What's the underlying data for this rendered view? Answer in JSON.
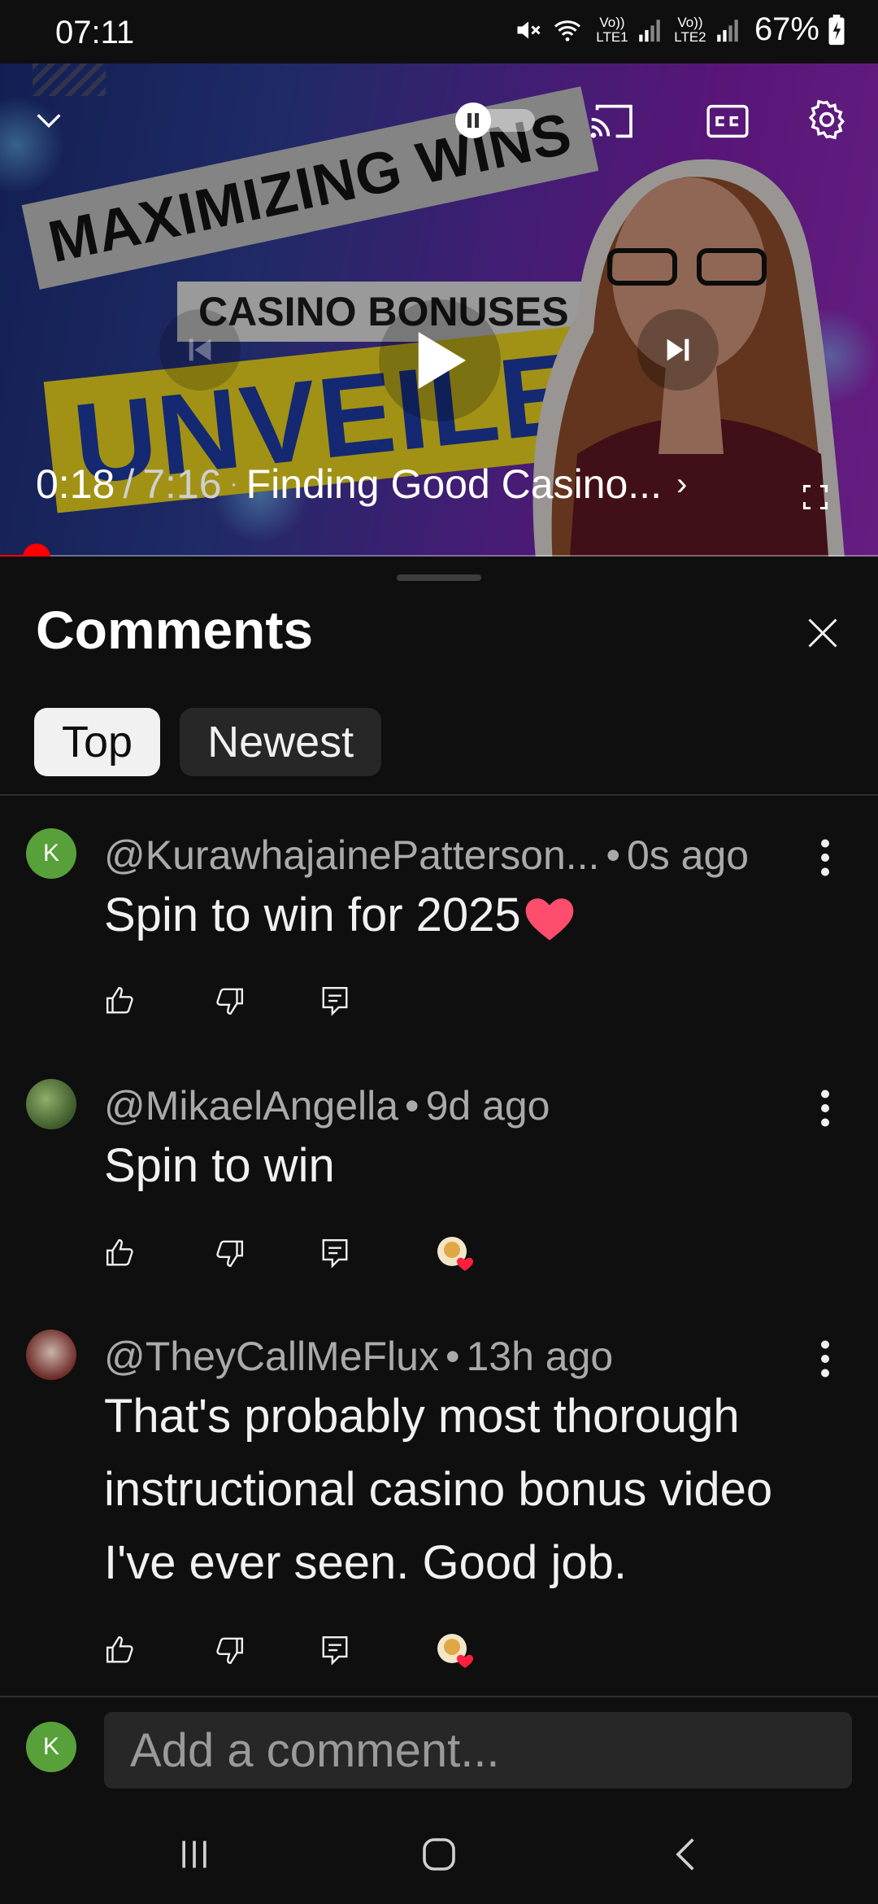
{
  "status_bar": {
    "time": "07:11",
    "sim1_label": "Vo)) LTE1",
    "sim2_label": "Vo)) LTE2",
    "battery_percent": "67%"
  },
  "player": {
    "thumbnail": {
      "line1": "MAXIMIZING WINS",
      "line2": "CASINO BONUSES",
      "line3": "UNVEILED"
    },
    "current_time": "0:18",
    "duration_separator": "/",
    "duration": "7:16",
    "chapter_title": "Finding Good Casino...",
    "progress_fraction": 0.042,
    "accent_color": "#ff0000",
    "icons": {
      "collapse": "chevron-down-icon",
      "autoplay": "autoplay-toggle",
      "cast": "cast-icon",
      "captions": "closed-captions-icon",
      "settings": "gear-icon",
      "previous": "skip-previous-icon",
      "play": "play-icon",
      "next": "skip-next-icon",
      "fullscreen": "fullscreen-icon"
    }
  },
  "comments_panel": {
    "title": "Comments",
    "filters": [
      {
        "label": "Top",
        "selected": true
      },
      {
        "label": "Newest",
        "selected": false
      }
    ],
    "comments": [
      {
        "avatar_letter": "K",
        "author": "@KurawhajainePatterson...",
        "time": "0s ago",
        "text": "Spin to win for 2025",
        "has_heart_emoji": true,
        "creator_hearted": false
      },
      {
        "avatar_letter": "",
        "author": "@MikaelAngella",
        "time": "9d ago",
        "text": "Spin to win",
        "creator_hearted": true
      },
      {
        "avatar_letter": "",
        "author": "@TheyCallMeFlux",
        "time": "13h ago",
        "text": "That's probably most thorough instructional casino bonus video I've ever seen. Good job.",
        "creator_hearted": true
      }
    ],
    "composer": {
      "avatar_letter": "K",
      "placeholder": "Add a comment..."
    }
  },
  "nav_bar": {
    "icons": [
      "recents-icon",
      "home-icon",
      "back-icon"
    ]
  }
}
